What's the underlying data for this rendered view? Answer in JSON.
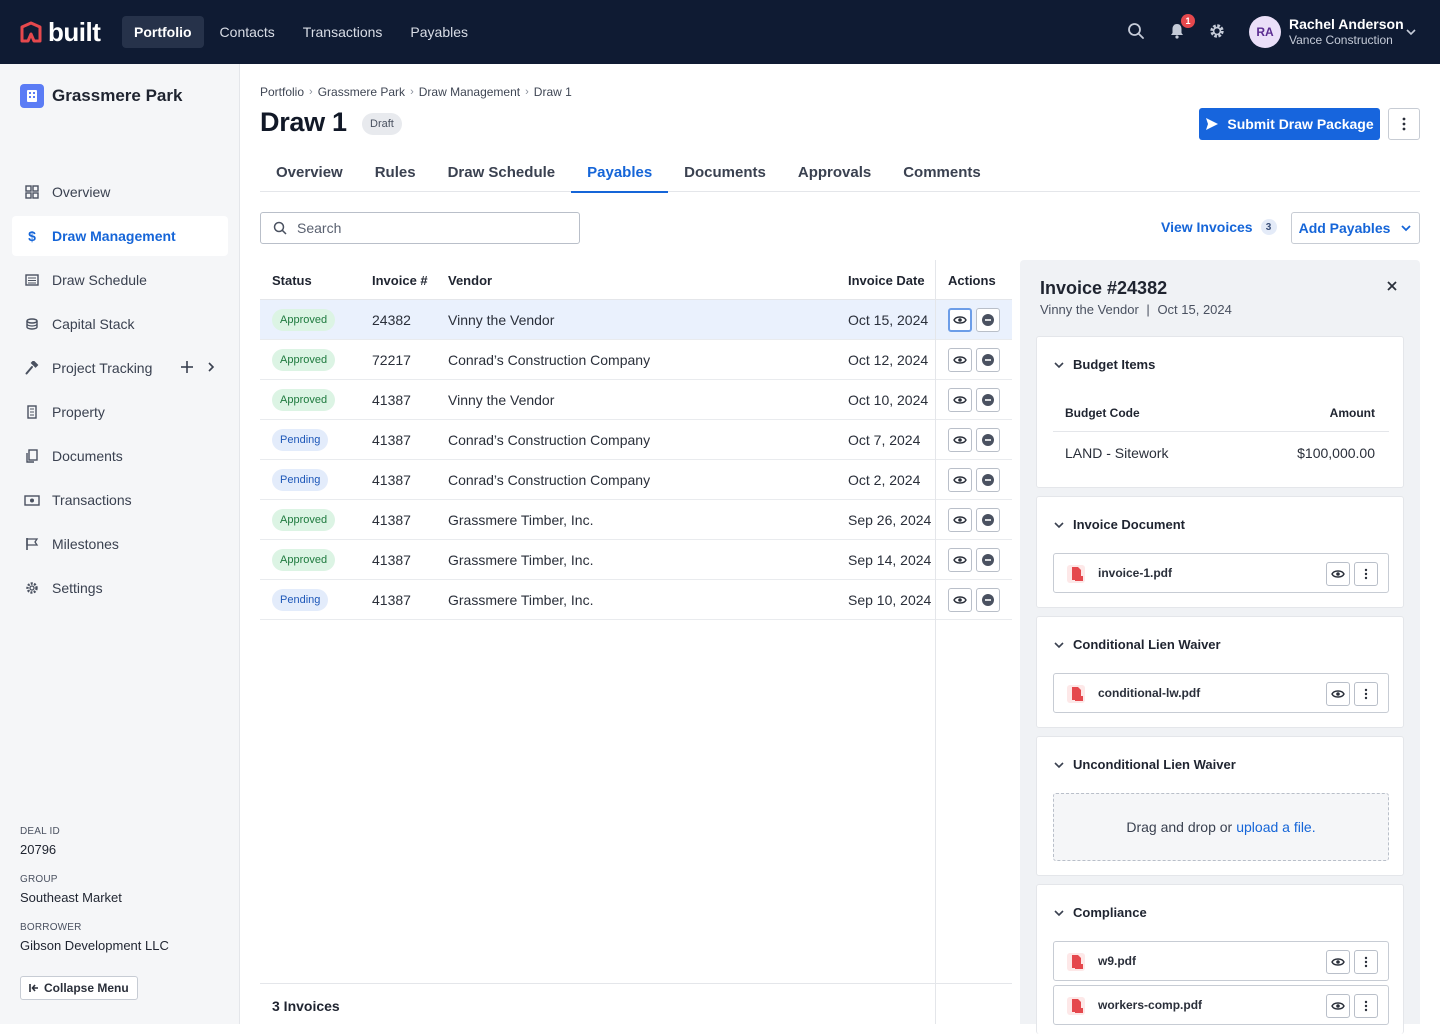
{
  "app": {
    "logo_text": "built"
  },
  "topnav": {
    "items": [
      {
        "label": "Portfolio",
        "active": true
      },
      {
        "label": "Contacts",
        "active": false
      },
      {
        "label": "Transactions",
        "active": false
      },
      {
        "label": "Payables",
        "active": false
      }
    ],
    "notification_count": "1",
    "user": {
      "initials": "RA",
      "name": "Rachel Anderson",
      "org": "Vance Construction"
    }
  },
  "sidebar": {
    "project_name": "Grassmere Park",
    "items": [
      {
        "label": "Overview",
        "icon": "grid-icon",
        "active": false
      },
      {
        "label": "Draw Management",
        "icon": "dollar-icon",
        "active": true
      },
      {
        "label": "Draw Schedule",
        "icon": "list-icon",
        "active": false
      },
      {
        "label": "Capital Stack",
        "icon": "stack-icon",
        "active": false
      },
      {
        "label": "Project Tracking",
        "icon": "hammer-icon",
        "active": false
      },
      {
        "label": "Property",
        "icon": "building-icon",
        "active": false
      },
      {
        "label": "Documents",
        "icon": "documents-icon",
        "active": false
      },
      {
        "label": "Transactions",
        "icon": "money-icon",
        "active": false
      },
      {
        "label": "Milestones",
        "icon": "flag-icon",
        "active": false
      },
      {
        "label": "Settings",
        "icon": "gear-icon",
        "active": false
      }
    ],
    "meta": [
      {
        "label": "Deal ID",
        "value": "20796"
      },
      {
        "label": "Group",
        "value": "Southeast Market"
      },
      {
        "label": "Borrower",
        "value": "Gibson Development LLC"
      }
    ],
    "collapse_label": "Collapse Menu"
  },
  "breadcrumb": [
    "Portfolio",
    "Grassmere Park",
    "Draw Management",
    "Draw 1"
  ],
  "page": {
    "title": "Draw 1",
    "status": "Draft",
    "submit_label": "Submit Draw Package"
  },
  "tabs": [
    {
      "label": "Overview",
      "active": false
    },
    {
      "label": "Rules",
      "active": false
    },
    {
      "label": "Draw Schedule",
      "active": false
    },
    {
      "label": "Payables",
      "active": true
    },
    {
      "label": "Documents",
      "active": false
    },
    {
      "label": "Approvals",
      "active": false
    },
    {
      "label": "Comments",
      "active": false
    }
  ],
  "toolbar": {
    "search_placeholder": "Search",
    "view_invoices_label": "View Invoices",
    "view_invoices_count": "3",
    "add_payables_label": "Add Payables"
  },
  "table": {
    "columns": [
      "Status",
      "Invoice #",
      "Vendor",
      "Invoice Date",
      "Actions"
    ],
    "rows": [
      {
        "status": "Approved",
        "invoice": "24382",
        "vendor": "Vinny the Vendor",
        "date": "Oct 15, 2024",
        "selected": true
      },
      {
        "status": "Approved",
        "invoice": "72217",
        "vendor": "Conrad’s Construction Company",
        "date": "Oct 12, 2024",
        "selected": false
      },
      {
        "status": "Approved",
        "invoice": "41387",
        "vendor": "Vinny the Vendor",
        "date": "Oct 10, 2024",
        "selected": false
      },
      {
        "status": "Pending",
        "invoice": "41387",
        "vendor": "Conrad’s Construction Company",
        "date": "Oct 7, 2024",
        "selected": false
      },
      {
        "status": "Pending",
        "invoice": "41387",
        "vendor": "Conrad’s Construction Company",
        "date": "Oct 2, 2024",
        "selected": false
      },
      {
        "status": "Approved",
        "invoice": "41387",
        "vendor": "Grassmere Timber, Inc.",
        "date": "Sep 26, 2024",
        "selected": false
      },
      {
        "status": "Approved",
        "invoice": "41387",
        "vendor": "Grassmere Timber, Inc.",
        "date": "Sep 14, 2024",
        "selected": false
      },
      {
        "status": "Pending",
        "invoice": "41387",
        "vendor": "Grassmere Timber, Inc.",
        "date": "Sep 10, 2024",
        "selected": false
      }
    ],
    "footer": "3 Invoices"
  },
  "panel": {
    "title": "Invoice #24382",
    "vendor": "Vinny the Vendor",
    "date": "Oct 15, 2024",
    "budget": {
      "heading": "Budget Items",
      "col_code": "Budget Code",
      "col_amount": "Amount",
      "code": "LAND - Sitework",
      "amount": "$100,000.00"
    },
    "invoice_doc": {
      "heading": "Invoice Document",
      "file": "invoice-1.pdf"
    },
    "conditional": {
      "heading": "Conditional Lien Waiver",
      "file": "conditional-lw.pdf"
    },
    "unconditional": {
      "heading": "Unconditional Lien Waiver",
      "drop_text": "Drag and drop or",
      "drop_link": "upload a file."
    },
    "compliance": {
      "heading": "Compliance",
      "files": [
        "w9.pdf",
        "workers-comp.pdf"
      ]
    }
  },
  "colors": {
    "nav_bg": "#0f1b33",
    "accent": "#1565d8",
    "approved_bg": "#dcf4e4",
    "pending_bg": "#e3ecfb"
  }
}
